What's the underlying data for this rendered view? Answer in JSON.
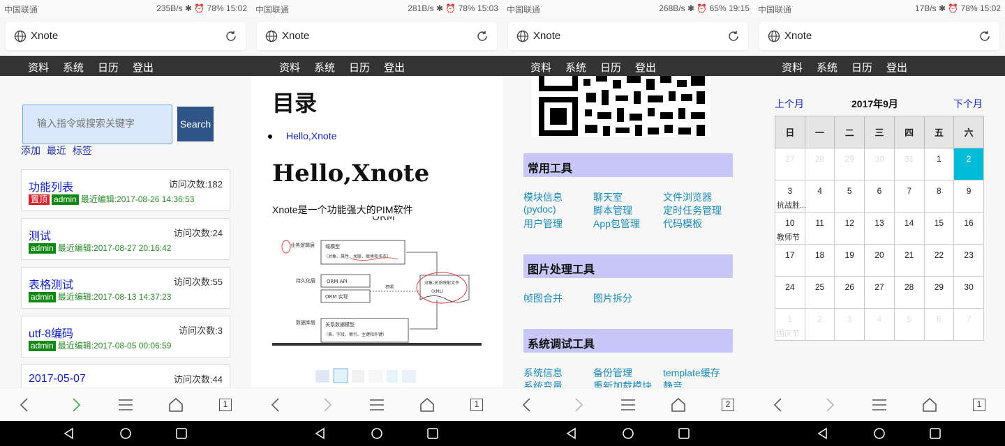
{
  "screens": [
    {
      "status": {
        "carrier": "中国联通",
        "right": "235B/s ✱ ⏰ 78% 15:02"
      },
      "addr_title": "Xnote",
      "nav": [
        "资料",
        "系统",
        "日历",
        "登出"
      ],
      "search": {
        "placeholder": "输入指令或搜索关键字",
        "button": "Search"
      },
      "quick_links": [
        "添加",
        "最近",
        "标签"
      ],
      "cards": [
        {
          "title": "功能列表",
          "visits": "访问次数:182",
          "badges": [
            "置顶",
            "admin"
          ],
          "meta": "最近编辑:2017-08-26 14:36:53"
        },
        {
          "title": "测试",
          "visits": "访问次数:24",
          "badges": [
            "admin"
          ],
          "meta": "最近编辑:2017-08-27 20:16:42"
        },
        {
          "title": "表格测试",
          "visits": "访问次数:55",
          "badges": [
            "admin"
          ],
          "meta": "最近编辑:2017-08-13 14:37:23"
        },
        {
          "title": "utf-8编码",
          "visits": "访问次数:3",
          "badges": [
            "admin"
          ],
          "meta": "最近编辑:2017-08-05 00:06:59"
        },
        {
          "title": "2017-05-07",
          "visits": "访问次数:44",
          "badges": [],
          "meta": ""
        }
      ],
      "tab_count": "1"
    },
    {
      "status": {
        "carrier": "中国联通",
        "right": "281B/s ✱ ⏰ 78% 15:03"
      },
      "addr_title": "Xnote",
      "nav": [
        "资料",
        "系统",
        "日历",
        "登出"
      ],
      "toc_heading": "目录",
      "toc_items": [
        "Hello,Xnote"
      ],
      "article_heading": "Hello,Xnote",
      "article_text": "Xnote是一个功能强大的PIM软件",
      "diagram_labels": {
        "layer_business": "业务逻辑层",
        "layer_persistence": "持久化层",
        "layer_database": "数据库层",
        "domain_model": "域模型",
        "domain_model_sub": "（对象、属性、关联、继承和多态）",
        "orm_api": "ORM API",
        "orm_impl": "ORM 实现",
        "reference": "参照",
        "mapping_file": "对象-关系映射文件",
        "mapping_file_sub": "(XML)",
        "relational_model": "关系数据模型",
        "relational_model_sub": "（表、字段、索引、主键和外键）",
        "orm_caption": "ORM"
      },
      "tab_count": "1"
    },
    {
      "status": {
        "carrier": "中国联通",
        "right": "268B/s ✱ ⏰ 65% 19:15"
      },
      "addr_title": "Xnote",
      "nav": [
        "资料",
        "系统",
        "日历",
        "登出"
      ],
      "sections": [
        {
          "title": "常用工具",
          "tools": [
            "模块信息",
            "(pydoc)",
            "用户管理",
            "聊天室",
            "脚本管理",
            "App包管理",
            "文件浏览器",
            "定时任务管理",
            "代码模板"
          ]
        },
        {
          "title": "图片处理工具",
          "tools": [
            "帧图合并",
            "图片拆分"
          ]
        },
        {
          "title": "系统调试工具",
          "tools": [
            "系统信息",
            "系统变量",
            "备份管理",
            "重新加载模块",
            "template缓存",
            "静音"
          ]
        }
      ],
      "tab_count": "2"
    },
    {
      "status": {
        "carrier": "中国联通",
        "right": "17B/s ✱ ⏰ 78% 15:02"
      },
      "addr_title": "Xnote",
      "nav": [
        "资料",
        "系统",
        "日历",
        "登出"
      ],
      "calendar": {
        "prev": "上个月",
        "title": "2017年9月",
        "next": "下个月",
        "weekdays": [
          "日",
          "一",
          "二",
          "三",
          "四",
          "五",
          "六"
        ],
        "weeks": [
          [
            "27",
            "28",
            "29",
            "30",
            "31",
            "1",
            "2"
          ],
          [
            "3",
            "4",
            "5",
            "6",
            "7",
            "8",
            "9"
          ],
          [
            "10",
            "11",
            "12",
            "13",
            "14",
            "15",
            "16"
          ],
          [
            "17",
            "18",
            "19",
            "20",
            "21",
            "22",
            "23"
          ],
          [
            "24",
            "25",
            "26",
            "27",
            "28",
            "29",
            "30"
          ],
          [
            "1",
            "2",
            "3",
            "4",
            "5",
            "6",
            "7"
          ]
        ],
        "events": {
          "w1d0": "抗战胜...",
          "w2d0": "教师节",
          "w5d0": "国庆节"
        }
      },
      "tab_count": "1"
    }
  ]
}
